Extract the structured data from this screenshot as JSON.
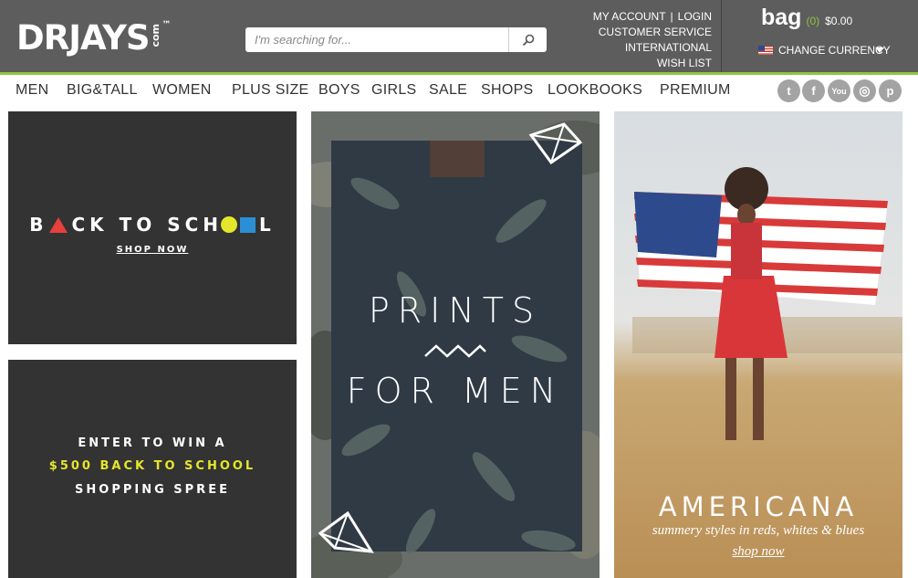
{
  "header": {
    "logo": {
      "main": "DRJAYS",
      "suffix": "com",
      "tm": "™"
    },
    "search": {
      "placeholder": "I'm searching for..."
    },
    "links": {
      "my_account": "MY ACCOUNT",
      "login": "LOGIN",
      "separator": "|",
      "customer_service": "CUSTOMER SERVICE",
      "international": "INTERNATIONAL",
      "wish_list": "WISH LIST"
    },
    "bag": {
      "label": "bag",
      "count": "(0)",
      "total": "$0.00"
    },
    "currency": {
      "label": "CHANGE CURRENCY"
    },
    "colors": {
      "bar": "#5d5d5d",
      "accent": "#8cc63f"
    }
  },
  "nav": {
    "items": [
      "MEN",
      "BIG&TALL",
      "WOMEN",
      "PLUS SIZE",
      "BOYS",
      "GIRLS",
      "SALE",
      "SHOPS",
      "LOOKBOOKS",
      "PREMIUM"
    ],
    "social": [
      {
        "icon": "twitter-icon",
        "glyph": "t"
      },
      {
        "icon": "facebook-icon",
        "glyph": "f"
      },
      {
        "icon": "youtube-icon",
        "glyph": "You"
      },
      {
        "icon": "instagram-icon",
        "glyph": "◎"
      },
      {
        "icon": "pinterest-icon",
        "glyph": "p"
      }
    ]
  },
  "promos": {
    "back_to_school": {
      "title_parts": [
        "B",
        "CK TO SCH",
        "L"
      ],
      "shop_now": "SHOP NOW"
    },
    "enter_to_win": {
      "line1": "ENTER TO WIN A",
      "line2": "$500 BACK TO SCHOOL",
      "line3": "SHOPPING SPREE"
    },
    "prints": {
      "line1": "PRINTS",
      "line2": "FOR MEN"
    },
    "americana": {
      "title": "AMERICANA",
      "subtitle": "summery styles in reds, whites & blues",
      "shop_now": "shop now"
    }
  }
}
